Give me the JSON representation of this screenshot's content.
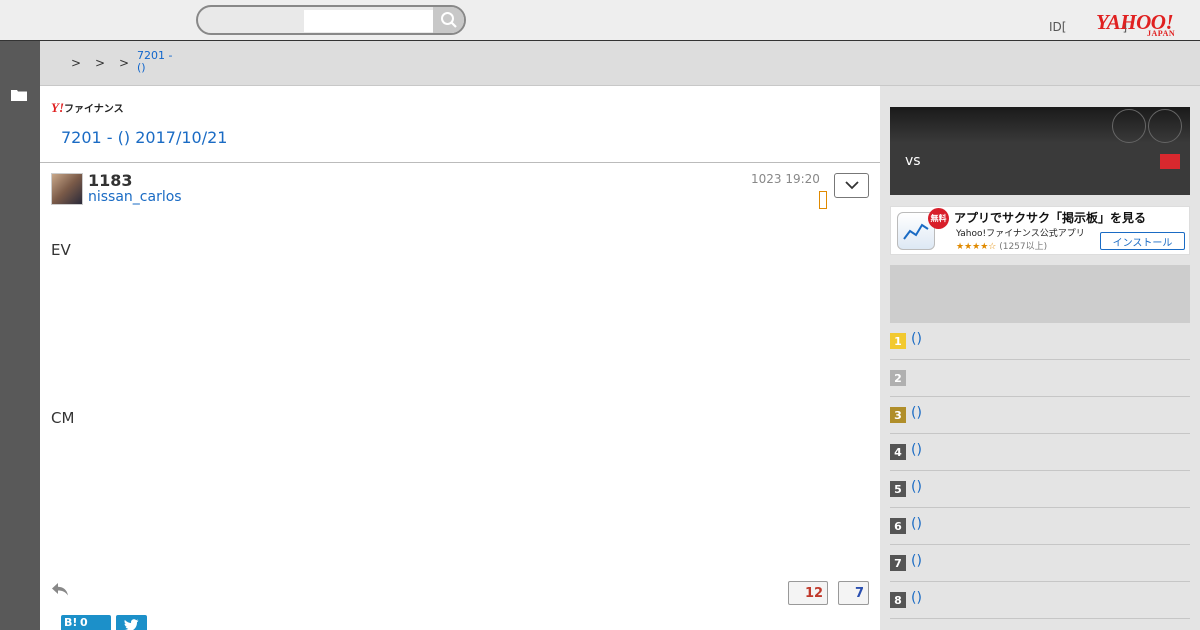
{
  "header": {
    "login_text": "ID[",
    "login_bracket": "]",
    "logo_main": "YAHOO!",
    "logo_sub": "JAPAN"
  },
  "breadcrumb": {
    "separators": [
      ">",
      ">",
      ">"
    ],
    "link_line1": "7201 -",
    "link_line2": "()"
  },
  "board": {
    "logo_y": "Y!",
    "logo_text": "ファイナンス",
    "title": "7201 - () 2017/10/21"
  },
  "post": {
    "number": "1183",
    "username": "nissan_carlos",
    "date": "1023 19:20",
    "line1": "EV",
    "line2": "CM",
    "likes": "12",
    "dislikes": "7"
  },
  "share": {
    "hatena": "B!",
    "hatena_count": "0"
  },
  "sidebar": {
    "promo_vs": "vs",
    "app_free": "無料",
    "app_headline": "アプリでサクサク「掲示板」を見る",
    "app_sub": "Yahoo!ファイナンス公式アプリ",
    "app_stars": "★★★★☆",
    "app_count": "(1257以上)",
    "app_install": "インストール",
    "ranking": [
      {
        "rank": "1",
        "text": "()",
        "color": "#f2c92f"
      },
      {
        "rank": "2",
        "text": "",
        "color": "#b0b0b0"
      },
      {
        "rank": "3",
        "text": "()",
        "color": "#b08e2a"
      },
      {
        "rank": "4",
        "text": "()",
        "color": "#555555"
      },
      {
        "rank": "5",
        "text": "()",
        "color": "#555555"
      },
      {
        "rank": "6",
        "text": "()",
        "color": "#555555"
      },
      {
        "rank": "7",
        "text": "()",
        "color": "#555555"
      },
      {
        "rank": "8",
        "text": "()",
        "color": "#555555"
      }
    ]
  }
}
